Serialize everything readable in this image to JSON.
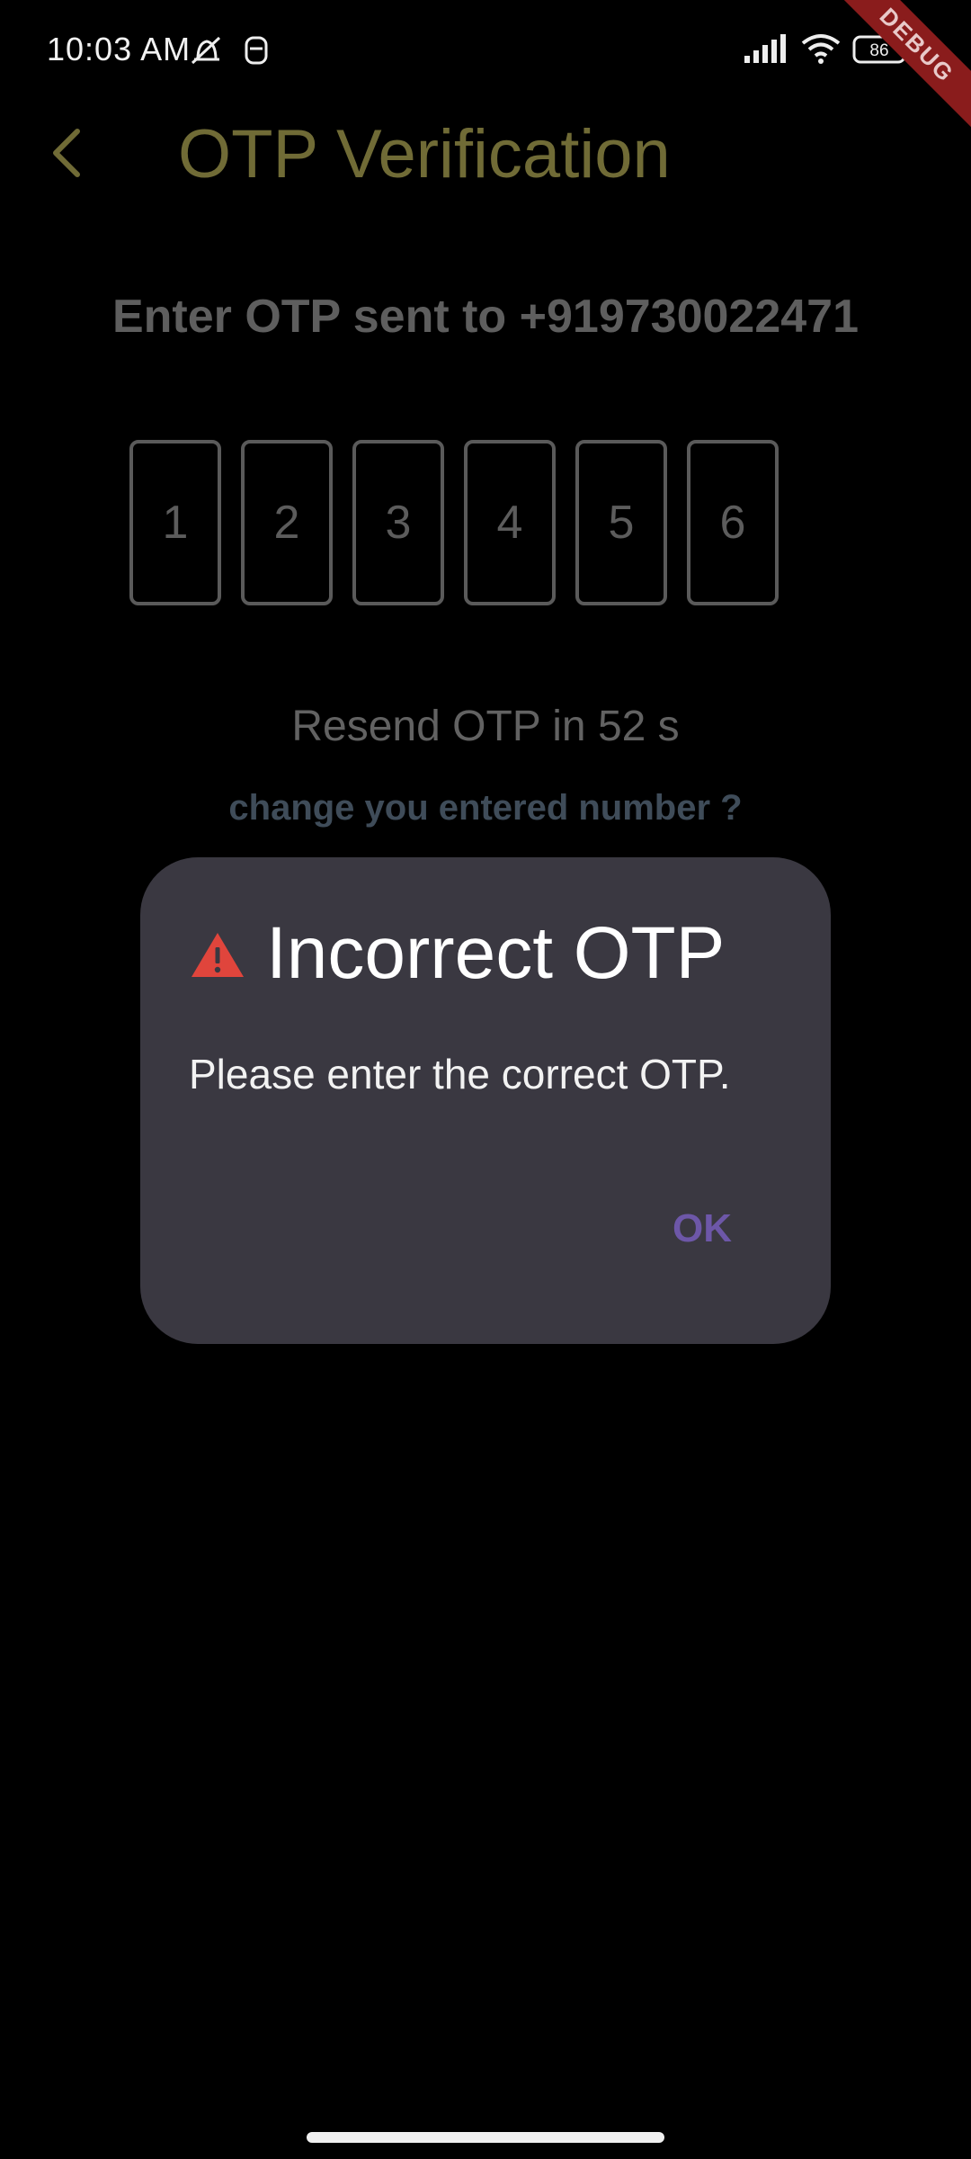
{
  "status_bar": {
    "time": "10:03 AM",
    "battery": "86",
    "debug_label": "DEBUG"
  },
  "app_bar": {
    "title": "OTP Verification"
  },
  "otp": {
    "prompt": "Enter OTP sent to +919730022471",
    "digits": [
      "1",
      "2",
      "3",
      "4",
      "5",
      "6"
    ],
    "resend_text": "Resend OTP in 52 s",
    "change_number_link": "change you entered number ?"
  },
  "dialog": {
    "title": "Incorrect OTP",
    "message": "Please enter the correct OTP.",
    "ok_label": "OK"
  },
  "colors": {
    "background": "#000000",
    "title_olive": "#706b36",
    "dialog_bg": "#3a3841",
    "warning_red": "#e0453c",
    "ok_purple": "#6d57a8",
    "link_blue_grey": "#3f4c59"
  }
}
